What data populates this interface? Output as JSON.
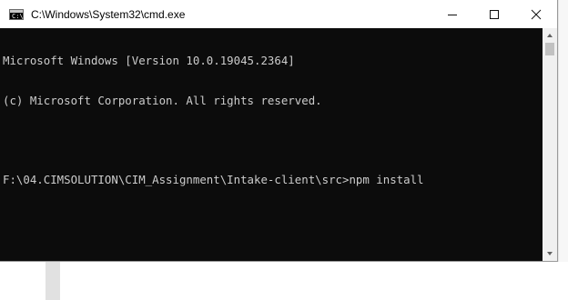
{
  "window": {
    "title": "C:\\Windows\\System32\\cmd.exe",
    "icon_prompt": "C:\\"
  },
  "controls": {
    "minimize": "minimize-icon",
    "maximize": "maximize-icon",
    "close": "close-icon"
  },
  "console": {
    "lines": [
      "Microsoft Windows [Version 10.0.19045.2364]",
      "(c) Microsoft Corporation. All rights reserved.",
      "",
      "F:\\04.CIMSOLUTION\\CIM_Assignment\\Intake-client\\src>npm install"
    ]
  },
  "colors": {
    "console_bg": "#0c0c0c",
    "console_fg": "#cccccc",
    "titlebar_bg": "#ffffff"
  }
}
